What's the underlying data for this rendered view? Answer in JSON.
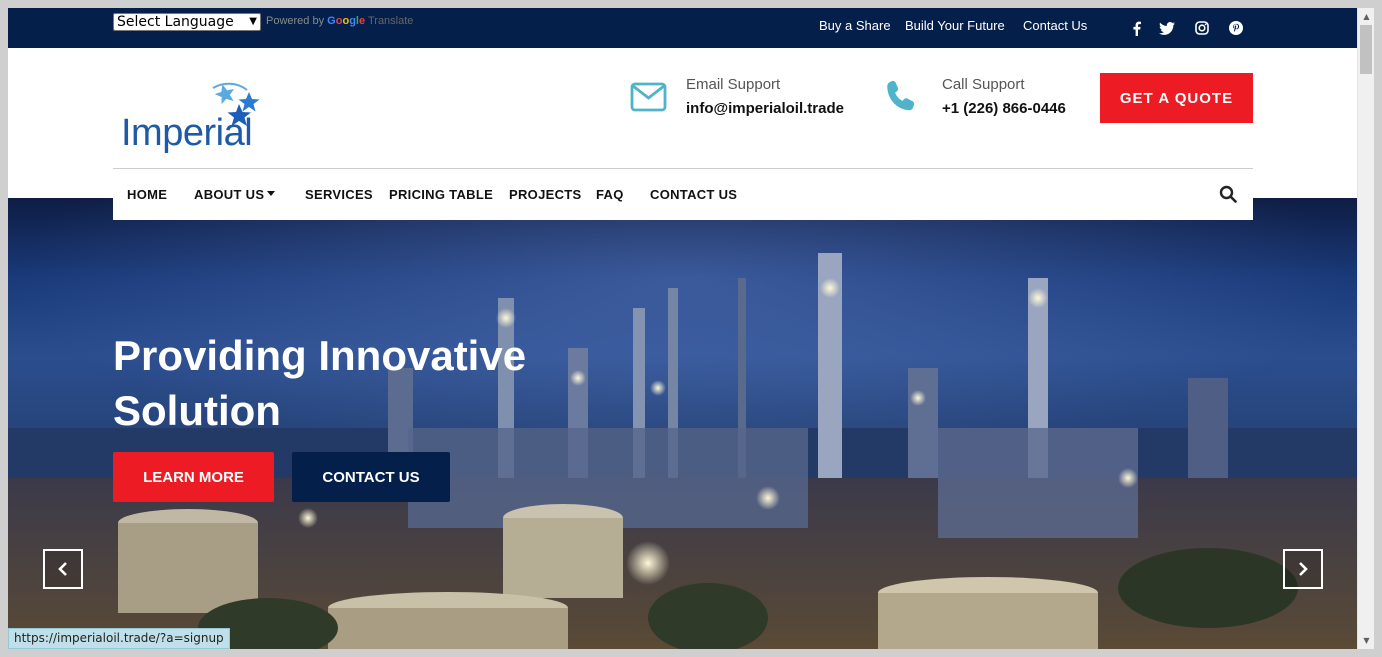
{
  "topbar": {
    "language_select": "Select Language",
    "powered_by": "Powered by",
    "google_letters": [
      "G",
      "o",
      "o",
      "g",
      "l",
      "e"
    ],
    "translate": "Translate",
    "links": [
      "Buy a Share",
      "Build Your Future",
      "Contact Us"
    ],
    "social_icons": [
      "facebook-icon",
      "twitter-icon",
      "instagram-icon",
      "pinterest-icon"
    ]
  },
  "header": {
    "logo_text": "Imperial",
    "email_label": "Email Support",
    "email_value": "info@imperialoil.trade",
    "call_label": "Call Support",
    "call_value": "+1 (226) 866-0446",
    "quote_button": "GET A QUOTE"
  },
  "nav": {
    "items": [
      "HOME",
      "ABOUT US",
      "SERVICES",
      "PRICING TABLE",
      "PROJECTS",
      "FAQ",
      "CONTACT US"
    ]
  },
  "hero": {
    "title_line1": "Providing Innovative",
    "title_line2": "Solution",
    "learn_more": "LEARN MORE",
    "contact_us": "CONTACT US"
  },
  "status_bar": {
    "url": "https://imperialoil.trade/?a=signup"
  },
  "colors": {
    "navy": "#04204a",
    "red": "#ed1c24",
    "teal": "#4fb4c9",
    "logo_blue": "#1f5aa6"
  }
}
